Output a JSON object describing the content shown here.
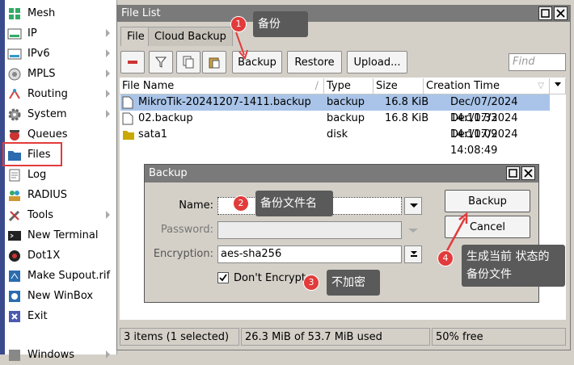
{
  "sidebar": {
    "items": [
      {
        "label": "Mesh",
        "icon": "mesh-icon",
        "arrow": false
      },
      {
        "label": "IP",
        "icon": "ip-icon",
        "arrow": true
      },
      {
        "label": "IPv6",
        "icon": "ipv6-icon",
        "arrow": true
      },
      {
        "label": "MPLS",
        "icon": "mpls-icon",
        "arrow": true
      },
      {
        "label": "Routing",
        "icon": "routing-icon",
        "arrow": true
      },
      {
        "label": "System",
        "icon": "gear-icon",
        "arrow": true
      },
      {
        "label": "Queues",
        "icon": "queues-icon",
        "arrow": false
      },
      {
        "label": "Files",
        "icon": "folder-icon",
        "arrow": false
      },
      {
        "label": "Log",
        "icon": "log-icon",
        "arrow": false
      },
      {
        "label": "RADIUS",
        "icon": "radius-icon",
        "arrow": false
      },
      {
        "label": "Tools",
        "icon": "tools-icon",
        "arrow": true
      },
      {
        "label": "New Terminal",
        "icon": "terminal-icon",
        "arrow": false
      },
      {
        "label": "Dot1X",
        "icon": "dot1x-icon",
        "arrow": false
      },
      {
        "label": "Make Supout.rif",
        "icon": "supout-icon",
        "arrow": false
      },
      {
        "label": "New WinBox",
        "icon": "winbox-icon",
        "arrow": false
      },
      {
        "label": "Exit",
        "icon": "exit-icon",
        "arrow": false
      },
      {
        "label": "Windows",
        "icon": "windows-icon",
        "arrow": true
      }
    ]
  },
  "window": {
    "title": "File List",
    "tabs": [
      "File",
      "Cloud Backup"
    ],
    "toolbar": {
      "backup": "Backup",
      "restore": "Restore",
      "upload": "Upload..."
    },
    "find_placeholder": "Find",
    "columns": [
      "File Name",
      "Type",
      "Size",
      "Creation Time"
    ],
    "rows": [
      {
        "name": "MikroTik-20241207-1411.backup",
        "type": "backup",
        "size": "16.8 KiB",
        "time": "Dec/07/2024 14:11:33",
        "icon": "file-icon"
      },
      {
        "name": "02.backup",
        "type": "backup",
        "size": "16.8 KiB",
        "time": "Dec/07/2024 14:11:09",
        "icon": "file-icon"
      },
      {
        "name": "sata1",
        "type": "disk",
        "size": "",
        "time": "Dec/07/2024 14:08:49",
        "icon": "folder-icon"
      }
    ],
    "status": {
      "count": "3 items (1 selected)",
      "usage": "26.3 MiB of 53.7 MiB used",
      "free": "50% free"
    }
  },
  "dialog": {
    "title": "Backup",
    "name_label": "Name:",
    "password_label": "Password:",
    "encryption_label": "Encryption:",
    "encryption_value": "aes-sha256",
    "dont_encrypt": "Don't Encrypt",
    "dont_encrypt_checked": true,
    "backup_button": "Backup",
    "cancel_button": "Cancel"
  },
  "annotations": {
    "n1": "1",
    "c1": "备份",
    "n2": "2",
    "c2": "备份文件名",
    "n3": "3",
    "c3": "不加密",
    "n4": "4",
    "c4_line1": "生成当前 状态的",
    "c4_line2": "备份文件"
  },
  "colors": {
    "highlight": "#e23b3b",
    "selection": "#a9c4e8",
    "titlebar": "#7a7a7a"
  }
}
